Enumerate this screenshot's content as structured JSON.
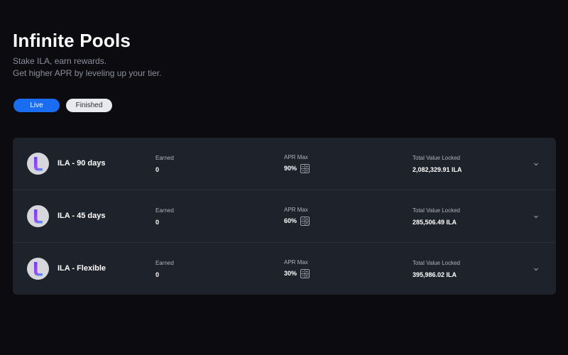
{
  "header": {
    "title": "Infinite Pools",
    "subtitle_line1": "Stake ILA, earn rewards.",
    "subtitle_line2": "Get higher APR by leveling up your tier."
  },
  "tabs": [
    {
      "label": "Live",
      "active": true
    },
    {
      "label": "Finished",
      "active": false
    }
  ],
  "pools": [
    {
      "name": "ILA - 90 days",
      "earned_label": "Earned",
      "earned_value": "0",
      "apr_label": "APR Max",
      "apr_value": "90%",
      "tvl_label": "Total Value Locked",
      "tvl_value": "2,082,329.91 ILA"
    },
    {
      "name": "ILA - 45 days",
      "earned_label": "Earned",
      "earned_value": "0",
      "apr_label": "APR Max",
      "apr_value": "60%",
      "tvl_label": "Total Value Locked",
      "tvl_value": "285,506.49 ILA"
    },
    {
      "name": "ILA - Flexible",
      "earned_label": "Earned",
      "earned_value": "0",
      "apr_label": "APR Max",
      "apr_value": "30%",
      "tvl_label": "Total Value Locked",
      "tvl_value": "395,986.02 ILA"
    }
  ],
  "icons": {
    "pool_logo": "ila-logo-icon",
    "calculator": "calculator-icon",
    "expand": "chevron-down-icon"
  },
  "colors": {
    "background": "#0c0c10",
    "card": "#1e222b",
    "accent": "#1a6cf0",
    "muted_text": "#8b8f9c"
  }
}
